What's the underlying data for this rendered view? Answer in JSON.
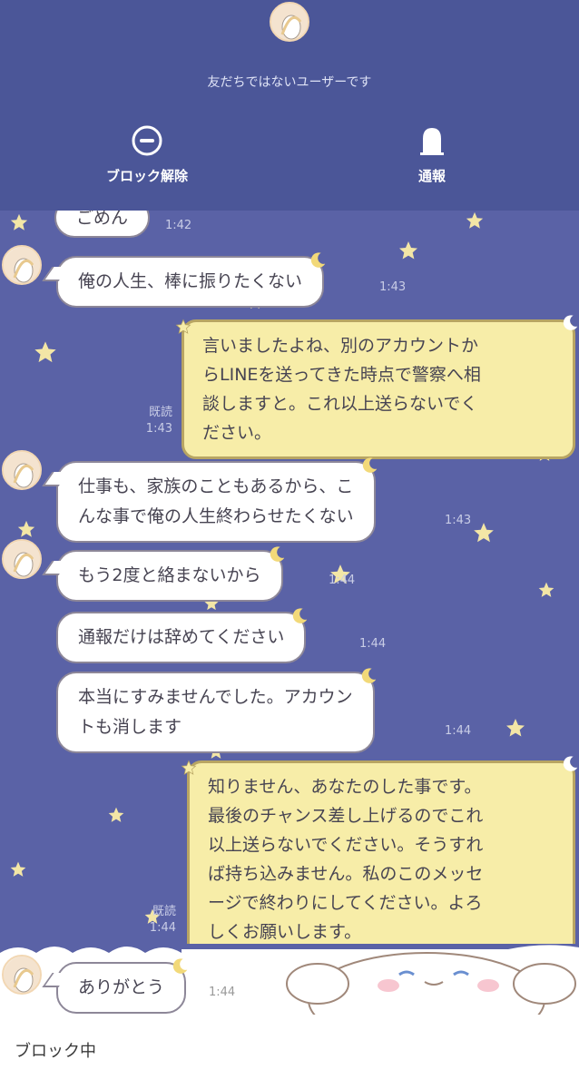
{
  "header": {
    "note": "友だちではないユーザーです",
    "unblock_label": "ブロック解除",
    "report_label": "通報"
  },
  "messages": [
    {
      "side": "left",
      "text": "ごめん",
      "time": "1:42"
    },
    {
      "side": "left",
      "text": "俺の人生、棒に振りたくない",
      "time": "1:43"
    },
    {
      "side": "right",
      "lines": [
        "言いましたよね、別のアカウントか",
        "らLINEを送ってきた時点で警察へ相",
        "談しますと。これ以上送らないでく",
        "ださい。"
      ],
      "read": "既読",
      "time": "1:43"
    },
    {
      "side": "left",
      "lines": [
        "仕事も、家族のこともあるから、こ",
        "んな事で俺の人生終わらせたくない"
      ],
      "time": "1:43"
    },
    {
      "side": "left",
      "text": "もう2度と絡まないから",
      "time": "1:44"
    },
    {
      "side": "left",
      "text": "通報だけは辞めてください",
      "time": "1:44"
    },
    {
      "side": "left",
      "lines": [
        "本当にすみませんでした。アカウン",
        "トも消します"
      ],
      "time": "1:44"
    },
    {
      "side": "right",
      "lines": [
        "知りません、あなたのした事です。",
        "最後のチャンス差し上げるのでこれ",
        "以上送らないでください。そうすれ",
        "ば持ち込みません。私のこのメッセ",
        "ージで終わりにしてください。よろ",
        "しくお願いします。"
      ],
      "read": "既読",
      "time": "1:44"
    },
    {
      "side": "left",
      "text": "ありがとう",
      "time": "1:44"
    }
  ],
  "footer": {
    "status": "ブロック中"
  },
  "colors": {
    "header_bg": "#4b5698",
    "chat_bg": "#5a62a6",
    "my_bubble": "#f7eda8",
    "their_bubble": "#ffffff",
    "star": "#f3e6a6"
  },
  "icons": {
    "unblock": "minus-circle-icon",
    "report": "bell-icon"
  }
}
